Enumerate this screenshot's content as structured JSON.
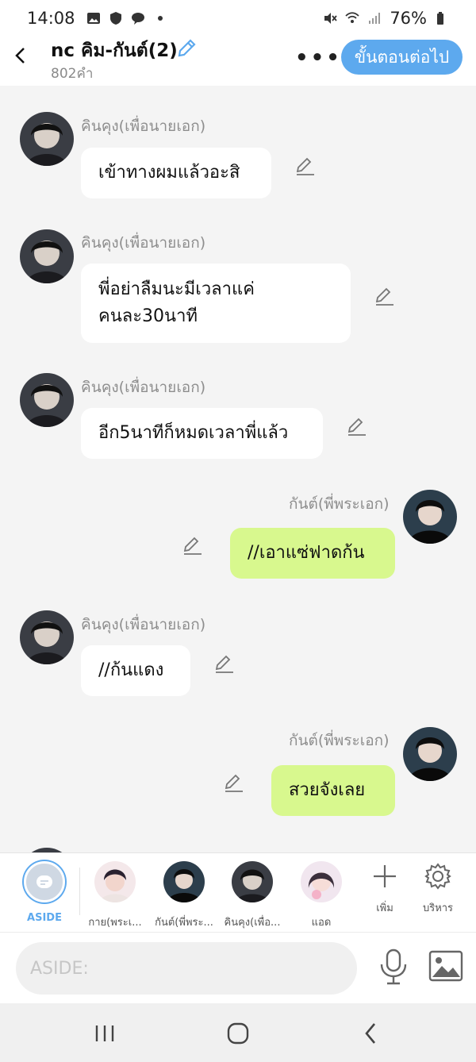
{
  "status_bar": {
    "time": "14:08",
    "battery": "76%"
  },
  "header": {
    "title": "nc คิม-กันต์(2)",
    "word_count": "802คำ",
    "next_label": "ขั้นตอนต่อไป"
  },
  "messages": [
    {
      "sender": "คินคุง(เพื่อนายเอก)",
      "text": "เข้าทางผมแล้วอะสิ",
      "mine": false
    },
    {
      "sender": "คินคุง(เพื่อนายเอก)",
      "line1": "พี่อย่าลืมนะมีเวลาแค่",
      "line2": "คนละ30นาที",
      "mine": false
    },
    {
      "sender": "คินคุง(เพื่อนายเอก)",
      "text": "อีก5นาทีก็หมดเวลาพี่แล้ว",
      "mine": false
    },
    {
      "sender": "กันต์(พี่พระเอก)",
      "text": "//เอาแซ่ฟาดก้น",
      "mine": true
    },
    {
      "sender": "คินคุง(เพื่อนายเอก)",
      "text": "//ก้นแดง",
      "mine": false
    },
    {
      "sender": "กันต์(พี่พระเอก)",
      "text": "สวยจังเลย",
      "mine": true
    }
  ],
  "characters": [
    {
      "label": "ASIDE",
      "active": true
    },
    {
      "label": "กาย(พระเ..."
    },
    {
      "label": "กันต์(พี่พระ..."
    },
    {
      "label": "คินคุง(เพื่อ..."
    },
    {
      "label": "แอด"
    }
  ],
  "tools": {
    "add_label": "เพิ่ม",
    "manage_label": "บริหาร"
  },
  "input": {
    "placeholder": "ASIDE:"
  },
  "colors": {
    "accent": "#5da9ee",
    "my_bubble": "#d8f88e",
    "their_bubble": "#ffffff"
  }
}
